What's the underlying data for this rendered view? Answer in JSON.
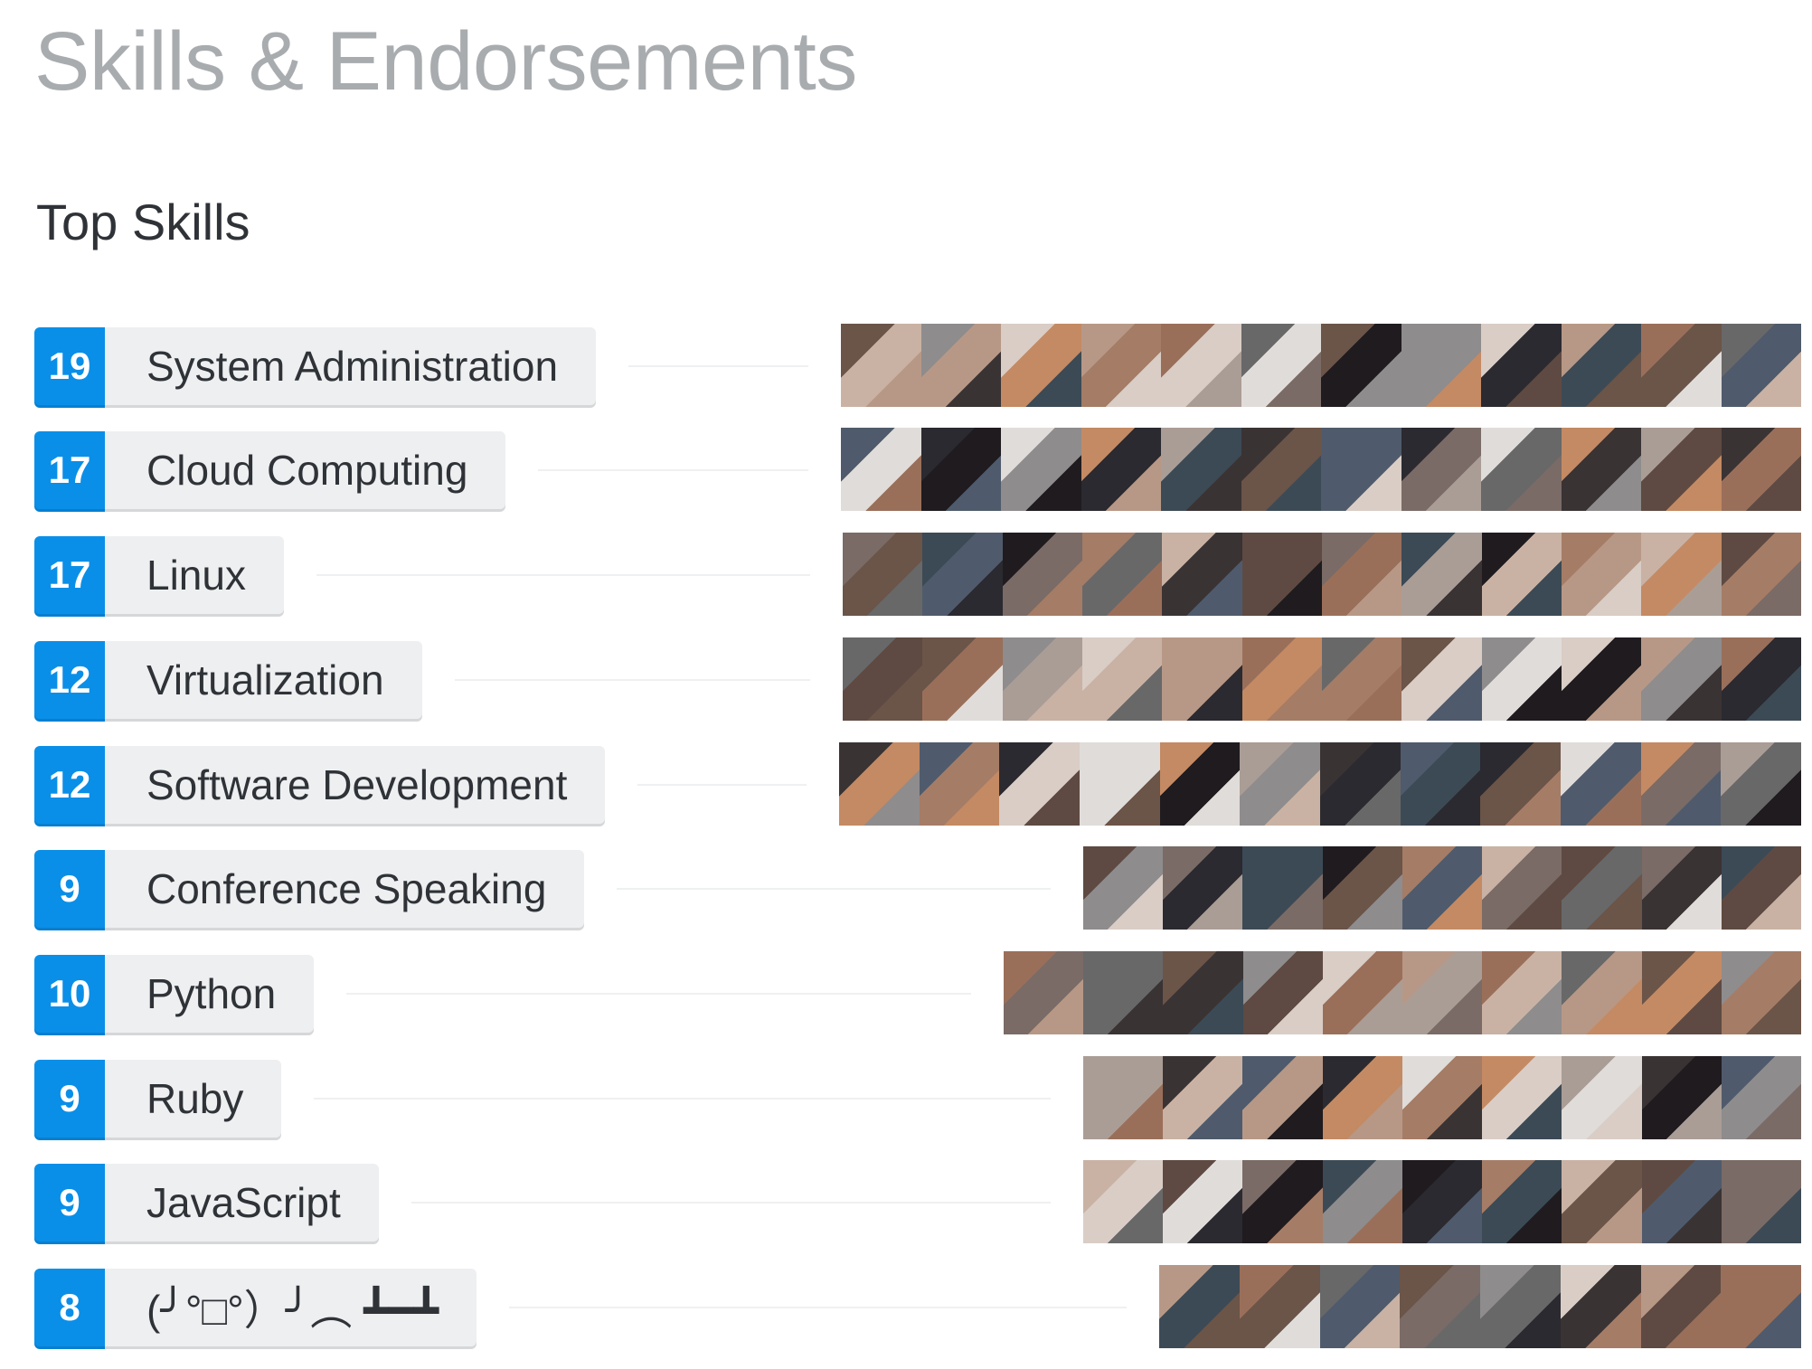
{
  "header": {
    "title": "Skills & Endorsements",
    "subtitle": "Top Skills"
  },
  "colors": {
    "count_bg": "#0a8fe8",
    "pill_bg": "#eeeff0",
    "title_color": "#a9acaf"
  },
  "skills": [
    {
      "count": "19",
      "name": "System Administration"
    },
    {
      "count": "17",
      "name": "Cloud Computing"
    },
    {
      "count": "17",
      "name": "Linux"
    },
    {
      "count": "12",
      "name": "Virtualization"
    },
    {
      "count": "12",
      "name": "Software Development"
    },
    {
      "count": "9",
      "name": "Conference Speaking"
    },
    {
      "count": "10",
      "name": "Python"
    },
    {
      "count": "9",
      "name": "Ruby"
    },
    {
      "count": "9",
      "name": "JavaScript"
    },
    {
      "count": "8",
      "name": "(╯°□°）╯︵ ┻━┻"
    }
  ]
}
